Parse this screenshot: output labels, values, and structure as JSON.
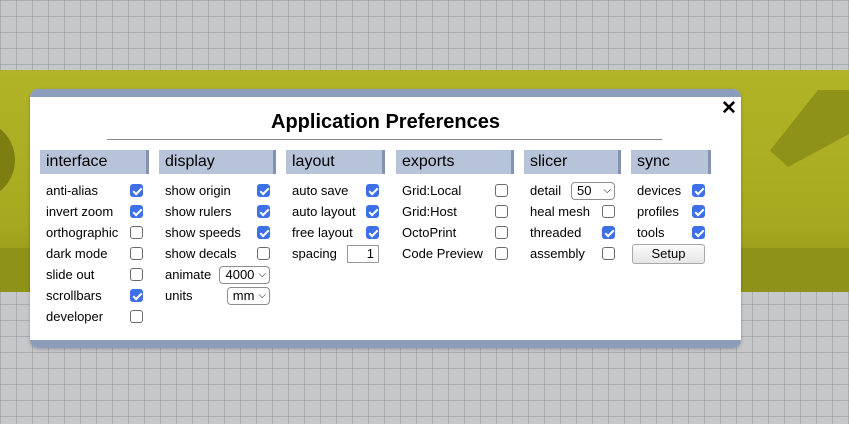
{
  "dialog": {
    "title": "Application Preferences",
    "close_glyph": "✕"
  },
  "interface": {
    "header": "interface",
    "items": [
      {
        "label": "anti-alias",
        "checked": true
      },
      {
        "label": "invert zoom",
        "checked": true
      },
      {
        "label": "orthographic",
        "checked": false
      },
      {
        "label": "dark mode",
        "checked": false
      },
      {
        "label": "slide out",
        "checked": false
      },
      {
        "label": "scrollbars",
        "checked": true
      },
      {
        "label": "developer",
        "checked": false
      }
    ]
  },
  "display": {
    "header": "display",
    "items": [
      {
        "label": "show origin",
        "checked": true
      },
      {
        "label": "show rulers",
        "checked": true
      },
      {
        "label": "show speeds",
        "checked": true
      },
      {
        "label": "show decals",
        "checked": false
      }
    ],
    "animate": {
      "label": "animate",
      "value": "4000"
    },
    "units": {
      "label": "units",
      "value": "mm"
    }
  },
  "layout": {
    "header": "layout",
    "items": [
      {
        "label": "auto save",
        "checked": true
      },
      {
        "label": "auto layout",
        "checked": true
      },
      {
        "label": "free layout",
        "checked": true
      }
    ],
    "spacing": {
      "label": "spacing",
      "value": "1"
    }
  },
  "exports": {
    "header": "exports",
    "items": [
      {
        "label": "Grid:Local",
        "checked": false
      },
      {
        "label": "Grid:Host",
        "checked": false
      },
      {
        "label": "OctoPrint",
        "checked": false
      },
      {
        "label": "Code Preview",
        "checked": false
      }
    ]
  },
  "slicer": {
    "header": "slicer",
    "detail": {
      "label": "detail",
      "value": "50"
    },
    "items": [
      {
        "label": "heal mesh",
        "checked": false
      },
      {
        "label": "threaded",
        "checked": true
      },
      {
        "label": "assembly",
        "checked": false
      }
    ]
  },
  "sync": {
    "header": "sync",
    "items": [
      {
        "label": "devices",
        "checked": true
      },
      {
        "label": "profiles",
        "checked": true
      },
      {
        "label": "tools",
        "checked": true
      }
    ],
    "setup_label": "Setup"
  },
  "icons": {
    "chevron": "chevron-down-icon",
    "close": "close-icon"
  }
}
